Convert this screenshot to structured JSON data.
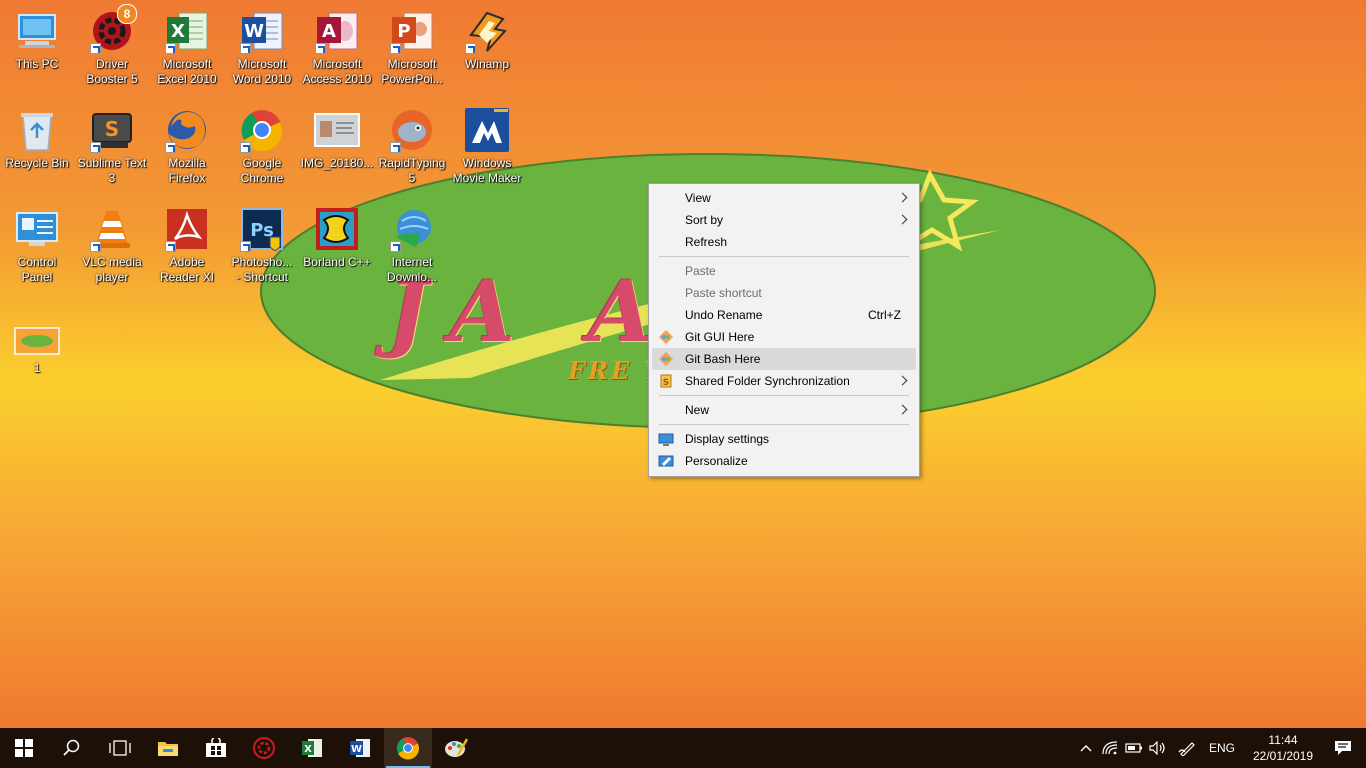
{
  "wallpaper": {
    "word": "JA  A",
    "tagline": "FRE        YOU"
  },
  "desktop_icons": [
    {
      "label": "This PC",
      "icon": "this-pc-icon"
    },
    {
      "label": "Driver\nBooster 5",
      "icon": "driver-booster-icon",
      "badge": "8"
    },
    {
      "label": "Microsoft\nExcel 2010",
      "icon": "excel-icon"
    },
    {
      "label": "Microsoft\nWord 2010",
      "icon": "word-icon"
    },
    {
      "label": "Microsoft\nAccess 2010",
      "icon": "access-icon"
    },
    {
      "label": "Microsoft\nPowerPoi...",
      "icon": "powerpoint-icon"
    },
    {
      "label": "Winamp",
      "icon": "winamp-icon"
    },
    {
      "label": "Recycle Bin",
      "icon": "recycle-bin-icon"
    },
    {
      "label": "Sublime Text\n3",
      "icon": "sublime-text-icon"
    },
    {
      "label": "Mozilla\nFirefox",
      "icon": "firefox-icon"
    },
    {
      "label": "Google\nChrome",
      "icon": "chrome-icon"
    },
    {
      "label": "IMG_20180...",
      "icon": "image-file-icon"
    },
    {
      "label": "RapidTyping\n5",
      "icon": "rapidtyping-icon"
    },
    {
      "label": "Windows\nMovie Maker",
      "icon": "movie-maker-icon"
    },
    {
      "label": "Control\nPanel",
      "icon": "control-panel-icon"
    },
    {
      "label": "VLC media\nplayer",
      "icon": "vlc-icon"
    },
    {
      "label": "Adobe\nReader XI",
      "icon": "adobe-reader-icon"
    },
    {
      "label": "Photosho...\n- Shortcut",
      "icon": "photoshop-icon"
    },
    {
      "label": "Borland C++",
      "icon": "borland-icon"
    },
    {
      "label": "Internet\nDownlo...",
      "icon": "idm-icon"
    },
    {
      "label": "1",
      "icon": "image-file-icon"
    }
  ],
  "context_menu": {
    "items": [
      {
        "label": "View",
        "submenu": true
      },
      {
        "label": "Sort by",
        "submenu": true
      },
      {
        "label": "Refresh"
      },
      {
        "label": "Paste",
        "disabled": true
      },
      {
        "label": "Paste shortcut",
        "disabled": true
      },
      {
        "label": "Undo Rename",
        "shortcut": "Ctrl+Z"
      },
      {
        "label": "Git GUI Here",
        "icon": "git-gui-icon"
      },
      {
        "label": "Git Bash Here",
        "icon": "git-bash-icon",
        "highlighted": true
      },
      {
        "label": "Shared Folder Synchronization",
        "icon": "sync-icon",
        "submenu": true
      },
      {
        "label": "New",
        "submenu": true
      },
      {
        "label": "Display settings",
        "icon": "display-icon"
      },
      {
        "label": "Personalize",
        "icon": "personalize-icon"
      }
    ]
  },
  "taskbar": {
    "pinned": [
      "start-icon",
      "search-icon",
      "task-view-icon",
      "file-explorer-icon",
      "store-icon",
      "driver-booster-icon",
      "excel-icon",
      "word-icon",
      "chrome-icon",
      "paint-icon"
    ],
    "active": "chrome-icon",
    "tray": {
      "language": "ENG",
      "time": "11:44",
      "date": "22/01/2019"
    }
  },
  "colors": {
    "menu_bg": "#f2f2f2",
    "menu_hover": "#dadada",
    "taskbar_bg": "#1d1006",
    "active_indicator": "#76b9ed",
    "oval_green": "#6bb33f"
  }
}
